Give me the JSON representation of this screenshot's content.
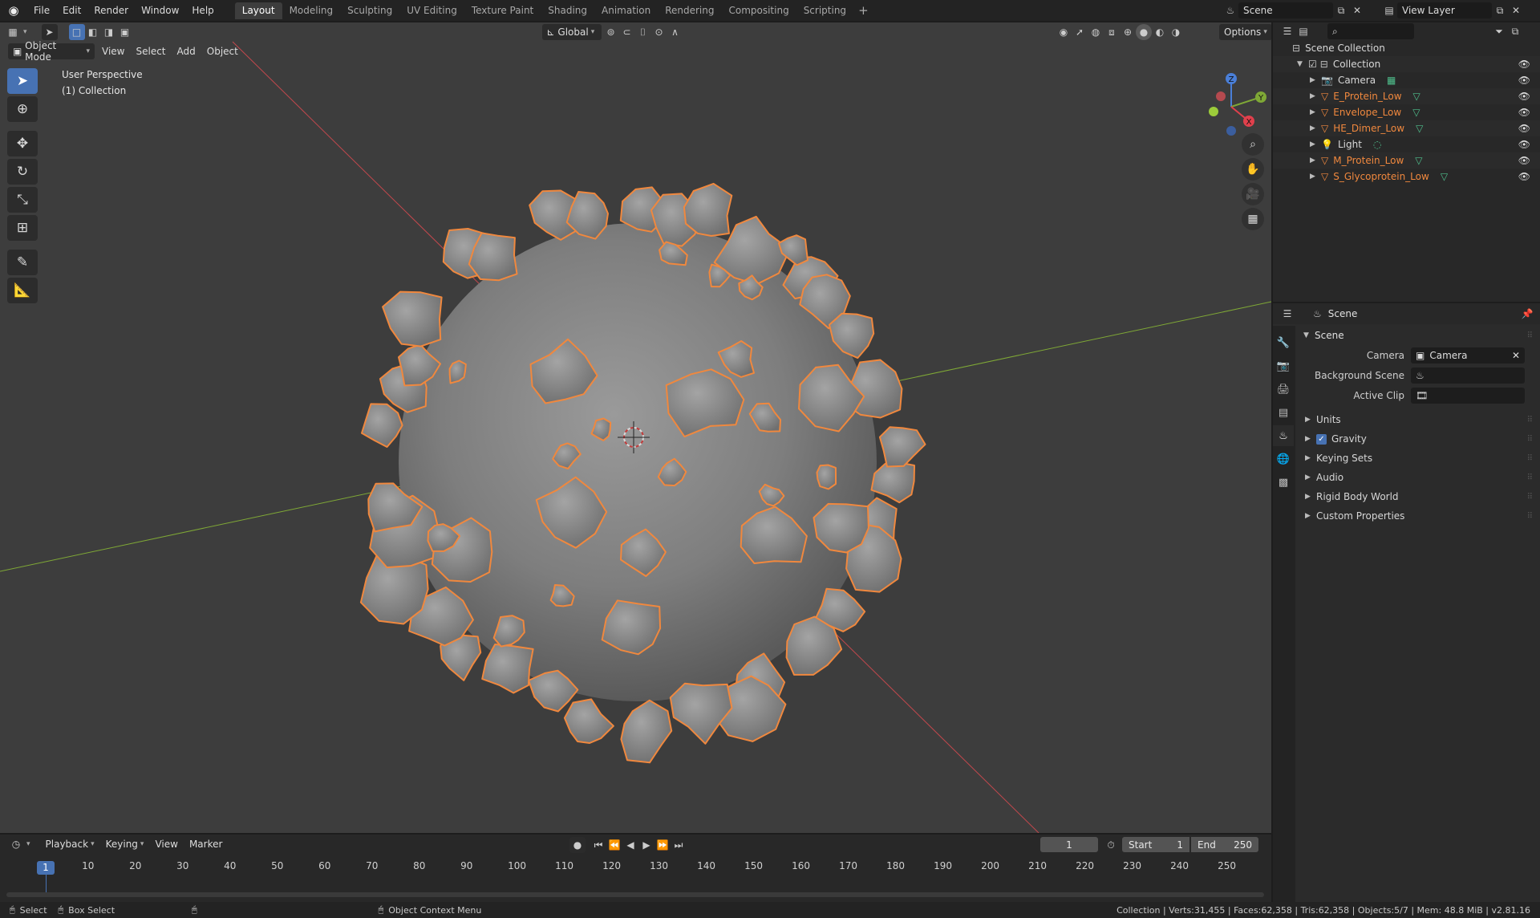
{
  "topbar": {
    "menus": [
      "File",
      "Edit",
      "Render",
      "Window",
      "Help"
    ],
    "workspaces": [
      "Layout",
      "Modeling",
      "Sculpting",
      "UV Editing",
      "Texture Paint",
      "Shading",
      "Animation",
      "Rendering",
      "Compositing",
      "Scripting"
    ],
    "active_workspace": "Layout",
    "scene": "Scene",
    "view_layer": "View Layer"
  },
  "viewport": {
    "mode": "Object Mode",
    "menus": [
      "View",
      "Select",
      "Add",
      "Object"
    ],
    "orientation": "Global",
    "options": "Options",
    "perspective_label": "User Perspective",
    "collection_label": "(1) Collection",
    "gizmo": {
      "z": "Z",
      "y": "Y",
      "x": "X"
    },
    "tools": [
      "select-box",
      "cursor",
      "move",
      "rotate",
      "scale",
      "transform",
      "annotate",
      "measure"
    ]
  },
  "outliner": {
    "root": "Scene Collection",
    "collection": "Collection",
    "items": [
      {
        "name": "Camera",
        "kind": "camera",
        "selected": false
      },
      {
        "name": "E_Protein_Low",
        "kind": "mesh",
        "selected": true
      },
      {
        "name": "Envelope_Low",
        "kind": "mesh",
        "selected": true
      },
      {
        "name": "HE_Dimer_Low",
        "kind": "mesh",
        "selected": true
      },
      {
        "name": "Light",
        "kind": "light",
        "selected": false
      },
      {
        "name": "M_Protein_Low",
        "kind": "mesh",
        "selected": true
      },
      {
        "name": "S_Glycoprotein_Low",
        "kind": "mesh",
        "selected": true
      }
    ],
    "colors": {
      "selected": "#f0883e",
      "mesh_icon": "#f0883e",
      "data_icon": "#4fc08d"
    }
  },
  "properties": {
    "context": "Scene",
    "panel_title": "Scene",
    "camera_label": "Camera",
    "camera_value": "Camera",
    "background_scene_label": "Background Scene",
    "active_clip_label": "Active Clip",
    "subpanels": [
      "Units",
      "Gravity",
      "Keying Sets",
      "Audio",
      "Rigid Body World",
      "Custom Properties"
    ],
    "gravity_checked": true
  },
  "timeline": {
    "menus": [
      "Playback",
      "Keying",
      "View",
      "Marker"
    ],
    "current_frame": "1",
    "start_label": "Start",
    "start_value": "1",
    "end_label": "End",
    "end_value": "250",
    "ticks": [
      "10",
      "20",
      "30",
      "40",
      "50",
      "60",
      "70",
      "80",
      "90",
      "100",
      "110",
      "120",
      "130",
      "140",
      "150",
      "160",
      "170",
      "180",
      "190",
      "200",
      "210",
      "220",
      "230",
      "240",
      "250"
    ],
    "playhead_label": "1"
  },
  "statusbar": {
    "select": "Select",
    "box_select": "Box Select",
    "context_menu": "Object Context Menu",
    "stats": "Collection | Verts:31,455 | Faces:62,358 | Tris:62,358 | Objects:5/7 | Mem: 48.8 MiB | v2.81.16"
  },
  "colors": {
    "accent": "#4772b3",
    "selection_outline": "#f0883e",
    "x_axis": "#c2484d",
    "y_axis": "#7fa836",
    "viewport_bg": "#3d3d3d"
  }
}
